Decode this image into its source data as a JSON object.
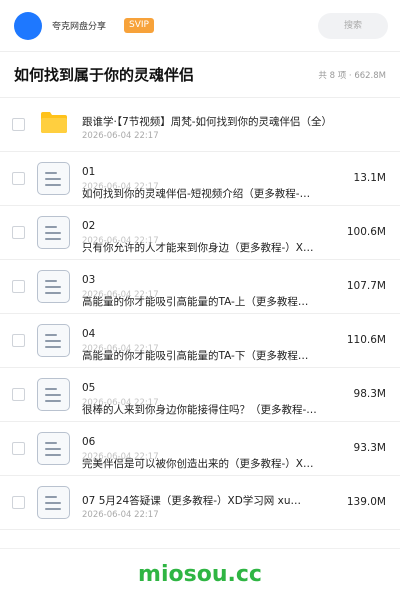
{
  "header": {
    "site_name": "夸克网盘分享",
    "badge": "SVIP",
    "search_placeholder": "搜索"
  },
  "folder": {
    "title": "如何找到属于你的灵魂伴侣",
    "summary": "共 8 项 · 662.8M"
  },
  "items": [
    {
      "type": "folder",
      "name": "跟谁学·【7节视频】周梵-如何找到你的灵魂伴侣（全）",
      "date": "2026-06-04 22:17",
      "size": ""
    },
    {
      "type": "file",
      "index": "01",
      "name": "如何找到你的灵魂伴侣-短视频介绍（更多教程-…",
      "date": "2026-06-04 22:17",
      "size": "13.1M"
    },
    {
      "type": "file",
      "index": "02",
      "name": "只有你允许的人才能来到你身边（更多教程-）X…",
      "date": "2026-06-04 22:17",
      "size": "100.6M"
    },
    {
      "type": "file",
      "index": "03",
      "name": "高能量的你才能吸引高能量的TA-上（更多教程…",
      "date": "2026-06-04 22:17",
      "size": "107.7M"
    },
    {
      "type": "file",
      "index": "04",
      "name": "高能量的你才能吸引高能量的TA-下（更多教程…",
      "date": "2026-06-04 22:17",
      "size": "110.6M"
    },
    {
      "type": "file",
      "index": "05",
      "name": "很棒的人来到你身边你能接得住吗？（更多教程-…",
      "date": "2026-06-04 22:17",
      "size": "98.3M"
    },
    {
      "type": "file",
      "index": "06",
      "name": "完美伴侣是可以被你创造出来的（更多教程-）X…",
      "date": "2026-06-04 22:17",
      "size": "93.3M"
    },
    {
      "type": "file",
      "index": "",
      "name": "07 5月24答疑课（更多教程-）XD学习网 xu…",
      "date": "2026-06-04 22:17",
      "size": "139.0M"
    }
  ],
  "footer": {
    "brand": "miosou.cc"
  },
  "colors": {
    "accent": "#1e78ff",
    "badge": "#f7a23a",
    "folder": "#ffc21a",
    "brand": "#2fb543"
  }
}
